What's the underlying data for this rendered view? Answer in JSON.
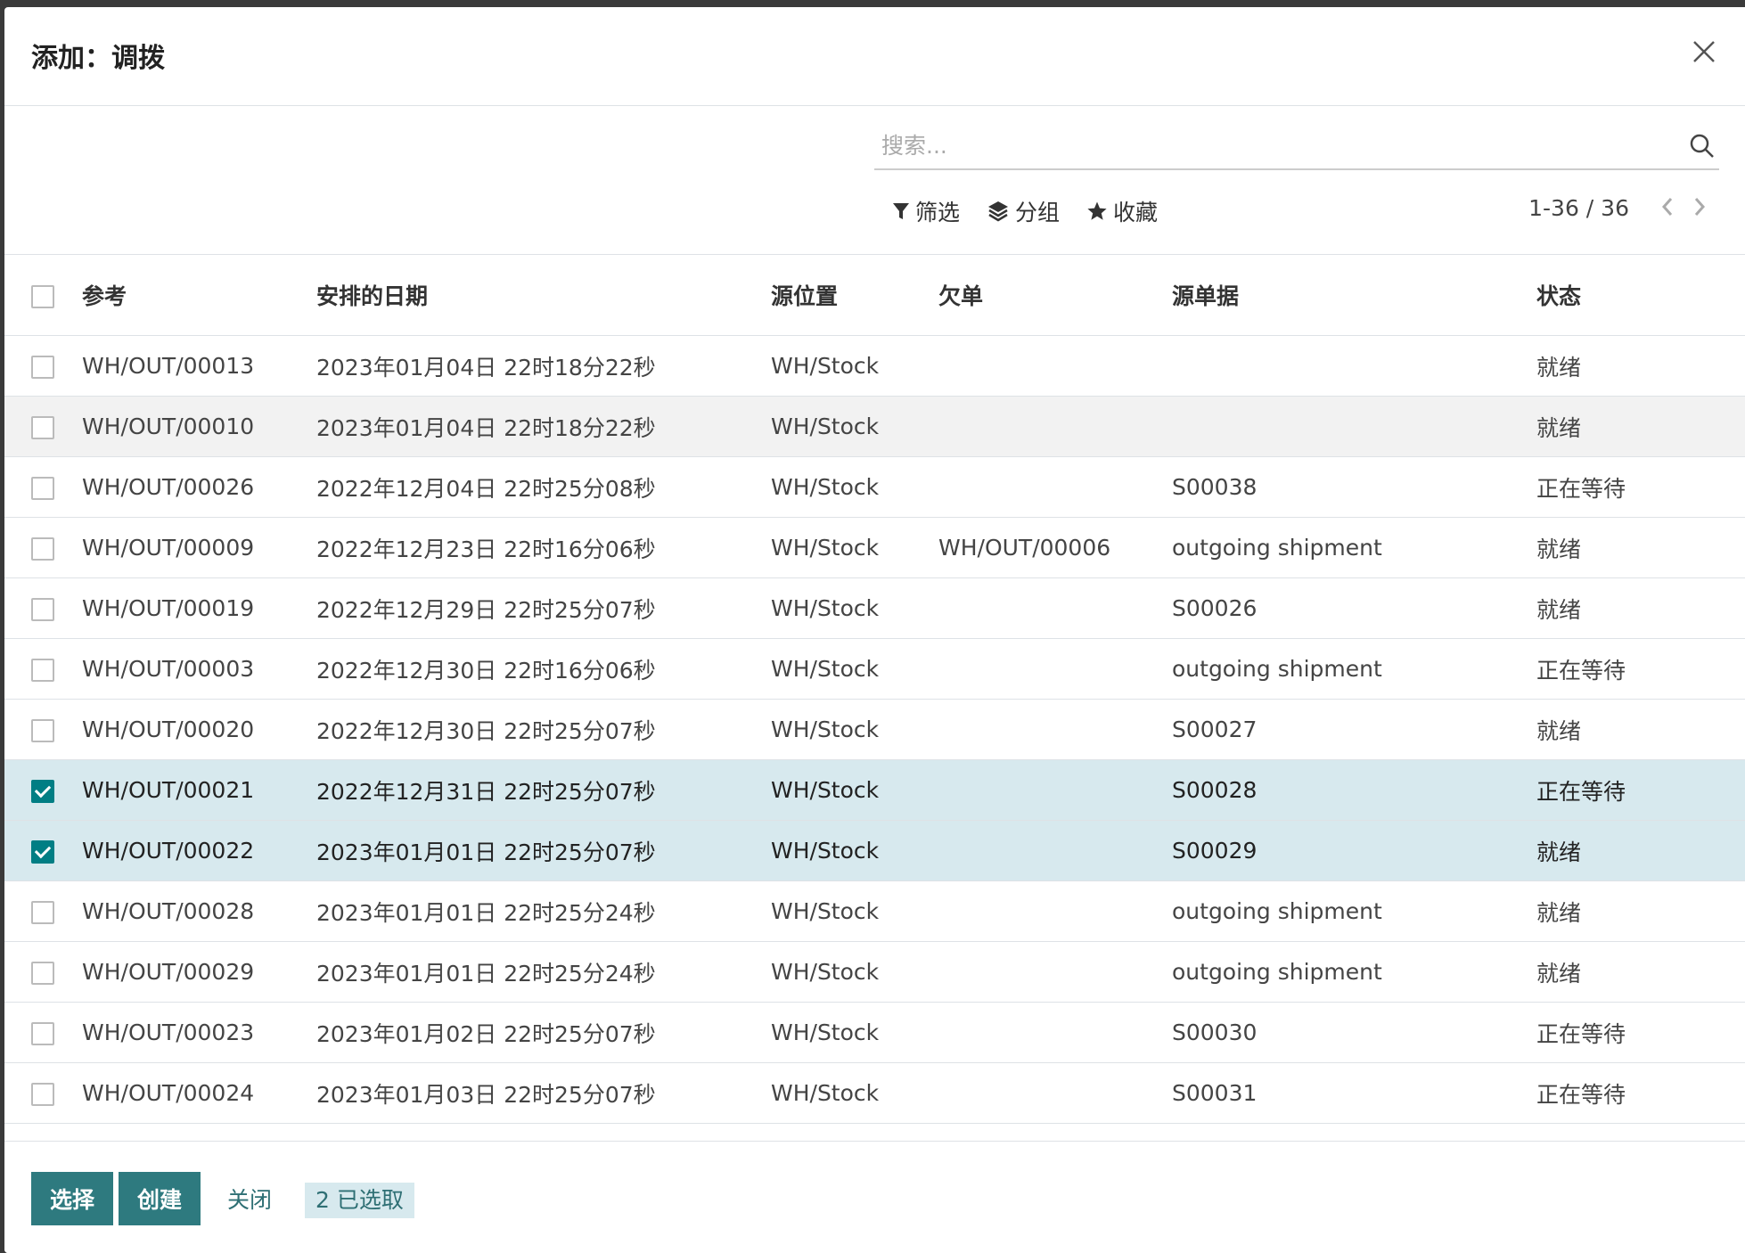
{
  "dialog": {
    "title": "添加：调拨"
  },
  "search": {
    "placeholder": "搜索..."
  },
  "filters": {
    "filter_label": "筛选",
    "group_label": "分组",
    "favorites_label": "收藏"
  },
  "pager": {
    "text": "1-36 / 36"
  },
  "table": {
    "headers": {
      "reference": "参考",
      "scheduled_date": "安排的日期",
      "source_location": "源位置",
      "backorder": "欠单",
      "source_document": "源单据",
      "status": "状态"
    },
    "rows": [
      {
        "reference": "WH/OUT/00013",
        "date": "2023年01月04日 22时18分22秒",
        "location": "WH/Stock",
        "backorder": "",
        "source": "",
        "status": "就绪",
        "checked": false
      },
      {
        "reference": "WH/OUT/00010",
        "date": "2023年01月04日 22时18分22秒",
        "location": "WH/Stock",
        "backorder": "",
        "source": "",
        "status": "就绪",
        "checked": false
      },
      {
        "reference": "WH/OUT/00026",
        "date": "2022年12月04日 22时25分08秒",
        "location": "WH/Stock",
        "backorder": "",
        "source": "S00038",
        "status": "正在等待",
        "checked": false
      },
      {
        "reference": "WH/OUT/00009",
        "date": "2022年12月23日 22时16分06秒",
        "location": "WH/Stock",
        "backorder": "WH/OUT/00006",
        "source": "outgoing shipment",
        "status": "就绪",
        "checked": false
      },
      {
        "reference": "WH/OUT/00019",
        "date": "2022年12月29日 22时25分07秒",
        "location": "WH/Stock",
        "backorder": "",
        "source": "S00026",
        "status": "就绪",
        "checked": false
      },
      {
        "reference": "WH/OUT/00003",
        "date": "2022年12月30日 22时16分06秒",
        "location": "WH/Stock",
        "backorder": "",
        "source": "outgoing shipment",
        "status": "正在等待",
        "checked": false
      },
      {
        "reference": "WH/OUT/00020",
        "date": "2022年12月30日 22时25分07秒",
        "location": "WH/Stock",
        "backorder": "",
        "source": "S00027",
        "status": "就绪",
        "checked": false
      },
      {
        "reference": "WH/OUT/00021",
        "date": "2022年12月31日 22时25分07秒",
        "location": "WH/Stock",
        "backorder": "",
        "source": "S00028",
        "status": "正在等待",
        "checked": true
      },
      {
        "reference": "WH/OUT/00022",
        "date": "2023年01月01日 22时25分07秒",
        "location": "WH/Stock",
        "backorder": "",
        "source": "S00029",
        "status": "就绪",
        "checked": true
      },
      {
        "reference": "WH/OUT/00028",
        "date": "2023年01月01日 22时25分24秒",
        "location": "WH/Stock",
        "backorder": "",
        "source": "outgoing shipment",
        "status": "就绪",
        "checked": false
      },
      {
        "reference": "WH/OUT/00029",
        "date": "2023年01月01日 22时25分24秒",
        "location": "WH/Stock",
        "backorder": "",
        "source": "outgoing shipment",
        "status": "就绪",
        "checked": false
      },
      {
        "reference": "WH/OUT/00023",
        "date": "2023年01月02日 22时25分07秒",
        "location": "WH/Stock",
        "backorder": "",
        "source": "S00030",
        "status": "正在等待",
        "checked": false
      },
      {
        "reference": "WH/OUT/00024",
        "date": "2023年01月03日 22时25分07秒",
        "location": "WH/Stock",
        "backorder": "",
        "source": "S00031",
        "status": "正在等待",
        "checked": false
      }
    ]
  },
  "footer": {
    "select_label": "选择",
    "create_label": "创建",
    "close_label": "关闭",
    "selected_count": "2 已选取"
  },
  "colors": {
    "primary": "#2e7a7f",
    "selected_row": "#d7e9ee",
    "checkbox_checked": "#017e84"
  }
}
